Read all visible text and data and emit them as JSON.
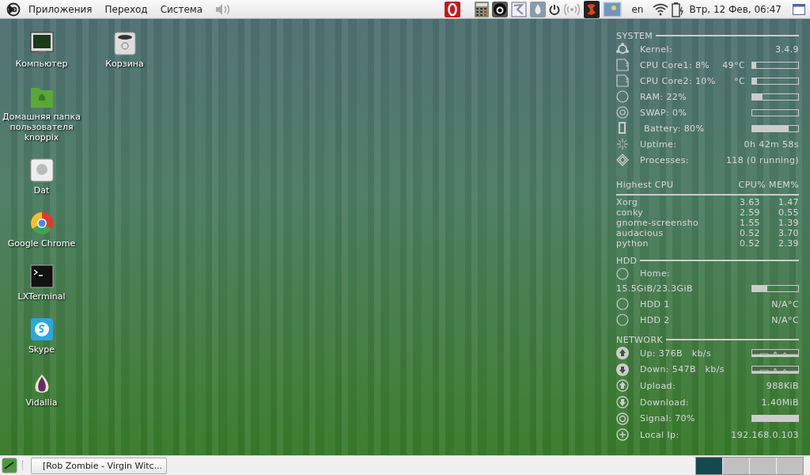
{
  "top_panel": {
    "menus": [
      "Приложения",
      "Переход",
      "Система"
    ],
    "language": "en",
    "clock": "Втр, 12 Фев, 06:47"
  },
  "desktop_columns": [
    {
      "icons": [
        {
          "label": "Компьютер"
        },
        {
          "label": "Домашняя папка пользователя knoppix"
        },
        {
          "label": "Dat"
        },
        {
          "label": "Google Chrome"
        },
        {
          "label": "LXTerminal"
        },
        {
          "label": "Skype"
        },
        {
          "label": "Vidallia"
        }
      ]
    },
    {
      "icons": [
        {
          "label": "Корзина"
        }
      ]
    }
  ],
  "conky": {
    "system": {
      "title": "SYSTEM",
      "rows": [
        {
          "kind": "text",
          "label": "Kernel:",
          "value": "3.4.9"
        },
        {
          "kind": "bar",
          "label": "CPU Core1: 8%",
          "temp": "49°C",
          "level": 0.08
        },
        {
          "kind": "bar",
          "label": "CPU Core2: 10%",
          "temp": "°C",
          "level": 0.1
        },
        {
          "kind": "bar",
          "label": "RAM: 22%",
          "level": 0.22
        },
        {
          "kind": "bar",
          "label": "SWAP: 0%",
          "level": 0
        },
        {
          "kind": "bar",
          "label": "Battery: 80%",
          "level": 0.8
        },
        {
          "kind": "text",
          "label": "Uptime:",
          "value": "0h 42m 58s"
        },
        {
          "kind": "text",
          "label": "Processes:",
          "value": "118 (0 running)"
        }
      ]
    },
    "processes": {
      "title": "Highest CPU",
      "columns": [
        "CPU%",
        "MEM%"
      ],
      "rows": [
        {
          "name": "Xorg",
          "cpu": "3.63",
          "mem": "1.47"
        },
        {
          "name": "conky",
          "cpu": "2.59",
          "mem": "0.55"
        },
        {
          "name": "gnome-screensho",
          "cpu": "1.55",
          "mem": "1.39"
        },
        {
          "name": "audacious",
          "cpu": "0.52",
          "mem": "3.70"
        },
        {
          "name": "python",
          "cpu": "0.52",
          "mem": "2.39"
        }
      ]
    },
    "hdd": {
      "title": "HDD",
      "home": {
        "label": "Home:",
        "usage": "15.5GiB/23.3GiB",
        "level": 0.33
      },
      "drives": [
        {
          "label": "HDD 1",
          "value": "N/A°C"
        },
        {
          "label": "HDD 2",
          "value": "N/A°C"
        }
      ]
    },
    "network": {
      "title": "NETWORK",
      "rows": [
        {
          "kind": "graph",
          "label": "Up: 376B   kb/s"
        },
        {
          "kind": "graph",
          "label": "Down: 547B   kb/s"
        },
        {
          "kind": "text",
          "label": "Upload:",
          "value": "988KiB"
        },
        {
          "kind": "text",
          "label": "Download:",
          "value": "1.40MiB"
        },
        {
          "kind": "bar",
          "label": "Signal: 70%",
          "level": 1
        },
        {
          "kind": "text",
          "label": "Local Ip:",
          "value": "192.168.0.103"
        }
      ]
    }
  },
  "bottom_panel": {
    "task": "[Rob Zombie - Virgin Witc...",
    "workspaces": [
      {
        "selected": true
      },
      {
        "selected": false
      },
      {
        "selected": false
      },
      {
        "selected": false
      }
    ]
  }
}
